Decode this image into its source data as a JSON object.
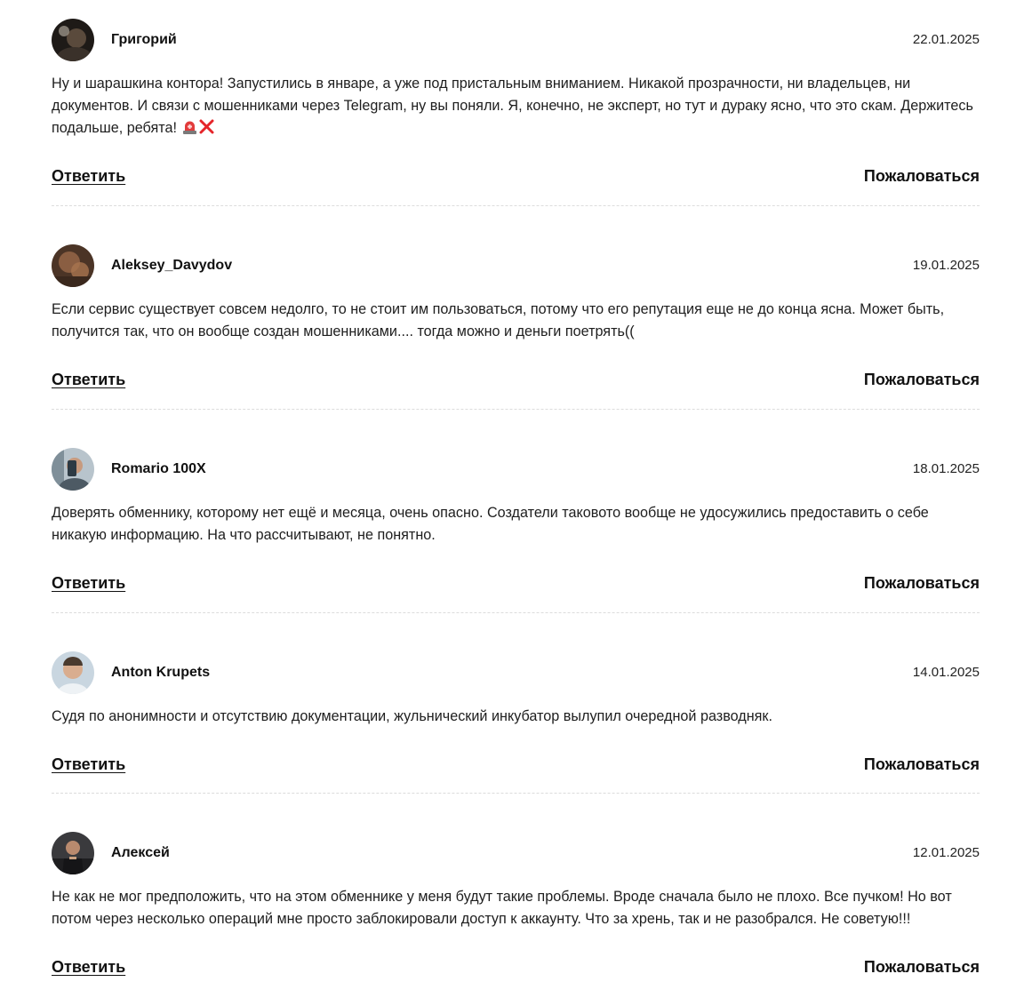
{
  "comments": [
    {
      "author": "Григорий",
      "date": "22.01.2025",
      "text": "Ну и шарашкина контора! Запустились в январе, а уже под пристальным вниманием. Никакой прозрачности, ни владельцев, ни документов. И связи с мошенниками через Telegram, ну вы поняли. Я, конечно, не эксперт, но тут и дураку ясно, что это скам. Держитесь подальше, ребята!",
      "emoji": [
        "police-light-icon",
        "cross-mark-icon"
      ],
      "reply_label": "Ответить",
      "report_label": "Пожаловаться",
      "avatar_color": "#2a2420"
    },
    {
      "author": "Aleksey_Davydov",
      "date": "19.01.2025",
      "text": "Если сервис существует совсем недолго, то не стоит им пользоваться, потому что его репутация еще не до конца ясна. Может быть, получится так, что он вообще создан мошенниками.... тогда можно и деньги поетрять((",
      "reply_label": "Ответить",
      "report_label": "Пожаловаться",
      "avatar_color": "#6b4a36"
    },
    {
      "author": "Romario 100X",
      "date": "18.01.2025",
      "text": "Доверять обменнику, которому нет ещё и месяца, очень опасно. Создатели таковото вообще не удосужились предоставить о себе никакую информацию. На что рассчитывают, не понятно.",
      "reply_label": "Ответить",
      "report_label": "Пожаловаться",
      "avatar_color": "#8a9aa4"
    },
    {
      "author": "Anton Krupets",
      "date": "14.01.2025",
      "text": "Судя по анонимности и отсутствию документации, жульнический инкубатор вылупил очередной разводняк.",
      "reply_label": "Ответить",
      "report_label": "Пожаловаться",
      "avatar_color": "#9fb2c2"
    },
    {
      "author": "Алексей",
      "date": "12.01.2025",
      "text": "Не как не мог предположить, что на этом обменнике у меня будут такие проблемы. Вроде сначала было не плохо. Все пучком! Но вот потом через несколько операций мне просто заблокировали доступ к аккаунту. Что за хрень, так и не разобрался. Не советую!!!",
      "reply_label": "Ответить",
      "report_label": "Пожаловаться",
      "avatar_color": "#2b2b2e"
    }
  ]
}
